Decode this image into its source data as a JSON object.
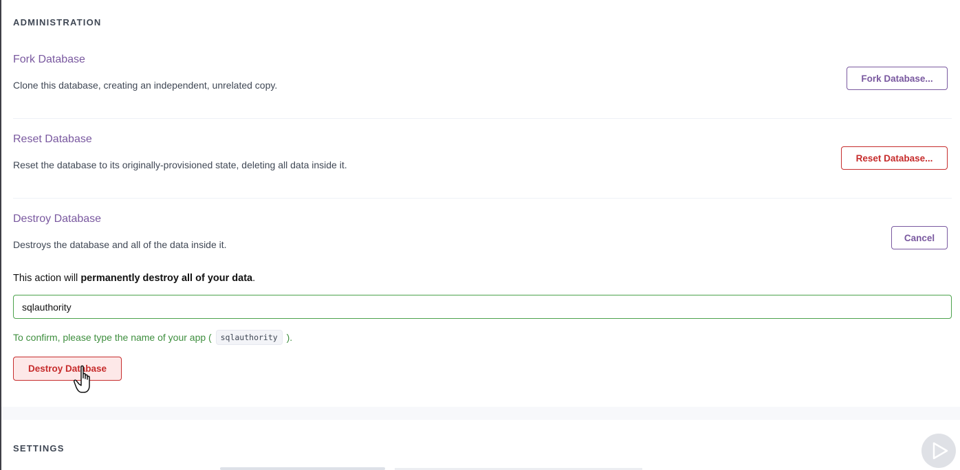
{
  "administration": {
    "heading": "ADMINISTRATION",
    "fork": {
      "title": "Fork Database",
      "description": "Clone this database, creating an independent, unrelated copy.",
      "button_label": "Fork Database..."
    },
    "reset": {
      "title": "Reset Database",
      "description": "Reset the database to its originally-provisioned state, deleting all data inside it.",
      "button_label": "Reset Database..."
    },
    "destroy": {
      "title": "Destroy Database",
      "description": "Destroys the database and all of the data inside it.",
      "cancel_label": "Cancel",
      "warning_prefix": "This action will ",
      "warning_bold": "permanently destroy all of your data",
      "warning_suffix": ".",
      "input_value": "sqlauthority",
      "hint_prefix": "To confirm, please type the name of your app ( ",
      "hint_code": "sqlauthority",
      "hint_suffix": " ).",
      "button_label": "Destroy Database"
    }
  },
  "settings": {
    "heading": "SETTINGS"
  },
  "colors": {
    "accent_purple": "#79589f",
    "danger_red": "#c62b2b",
    "success_green": "#3e8e3e"
  },
  "icons": {
    "cursor": "hand-pointer-icon",
    "player": "play-icon"
  }
}
